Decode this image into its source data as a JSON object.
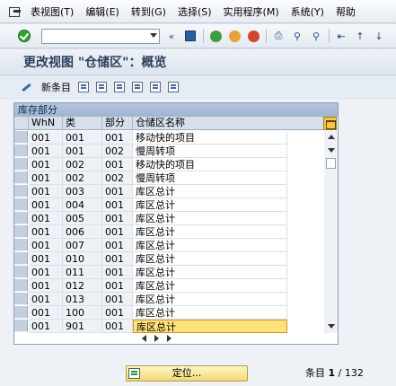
{
  "menu": {
    "items": [
      "表视图(T)",
      "编辑(E)",
      "转到(G)",
      "选择(S)",
      "实用程序(M)",
      "系统(Y)",
      "帮助"
    ]
  },
  "toolbar": {
    "command_value": "",
    "icons": [
      "ok-icon",
      "save-icon",
      "back-icon",
      "exit-icon",
      "cancel-icon",
      "print-icon",
      "find-icon",
      "find-next-icon",
      "first-page-icon",
      "prev-page-icon",
      "next-page-icon"
    ]
  },
  "title": "更改视图 \"仓储区\"：概览",
  "app_toolbar": {
    "new_entries_label": "新条目",
    "icons": [
      "copy-icon",
      "delete-icon",
      "undo-icon",
      "select-all-icon",
      "select-block-icon",
      "deselect-all-icon"
    ]
  },
  "panel": {
    "title": "库存部分",
    "columns": [
      "WhN",
      "类",
      "部分",
      "仓储区名称"
    ],
    "rows": [
      [
        "001",
        "001",
        "001",
        "移动快的项目"
      ],
      [
        "001",
        "001",
        "002",
        "慢周转项"
      ],
      [
        "001",
        "002",
        "001",
        "移动快的项目"
      ],
      [
        "001",
        "002",
        "002",
        "慢周转项"
      ],
      [
        "001",
        "003",
        "001",
        "库区总计"
      ],
      [
        "001",
        "004",
        "001",
        "库区总计"
      ],
      [
        "001",
        "005",
        "001",
        "库区总计"
      ],
      [
        "001",
        "006",
        "001",
        "库区总计"
      ],
      [
        "001",
        "007",
        "001",
        "库区总计"
      ],
      [
        "001",
        "010",
        "001",
        "库区总计"
      ],
      [
        "001",
        "011",
        "001",
        "库区总计"
      ],
      [
        "001",
        "012",
        "001",
        "库区总计"
      ],
      [
        "001",
        "013",
        "001",
        "库区总计"
      ],
      [
        "001",
        "100",
        "001",
        "库区总计"
      ],
      [
        "001",
        "901",
        "001",
        "库区总计"
      ]
    ]
  },
  "footer": {
    "position_button_label": "定位...",
    "entry_label": "条目",
    "entry_current": "1",
    "entry_total": "/ 132"
  }
}
